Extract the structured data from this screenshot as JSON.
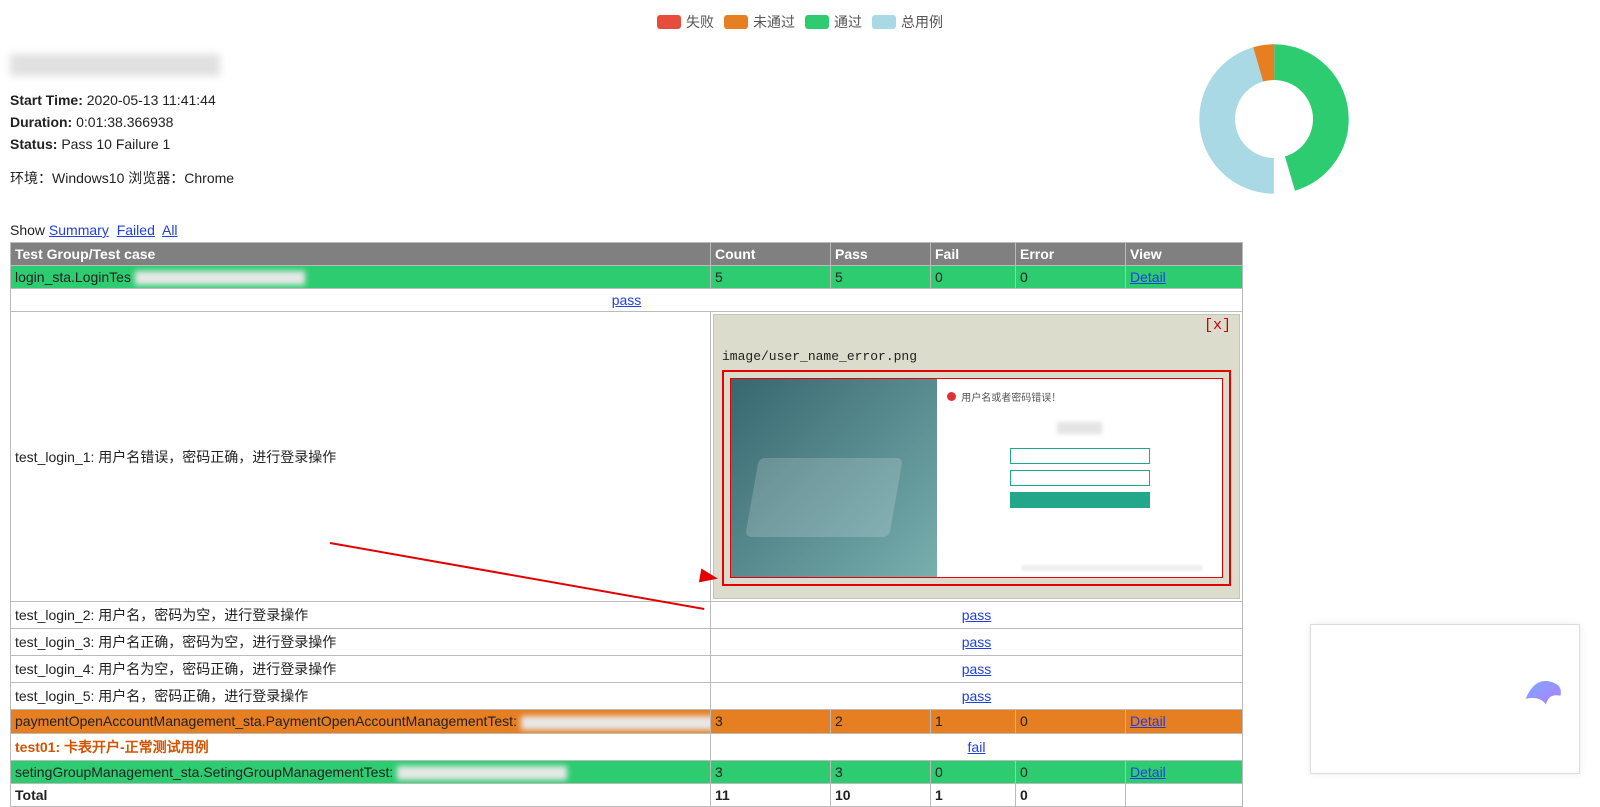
{
  "legend": {
    "fail": {
      "label": "失败",
      "color": "#e74c3c"
    },
    "notrun": {
      "label": "未通过",
      "color": "#e67e22"
    },
    "pass": {
      "label": "通过",
      "color": "#2ecc71"
    },
    "total": {
      "label": "总用例",
      "color": "#a9d9e5"
    }
  },
  "meta": {
    "start_label": "Start Time:",
    "start_value": "2020-05-13 11:41:44",
    "duration_label": "Duration:",
    "duration_value": "0:01:38.366938",
    "status_label": "Status:",
    "status_value": "Pass 10 Failure 1",
    "env": "环境：Windows10 浏览器：Chrome"
  },
  "show_line": {
    "prefix": "Show",
    "summary": "Summary",
    "failed": "Failed",
    "all": "All"
  },
  "columns": {
    "c0": "Test Group/Test case",
    "c1": "Count",
    "c2": "Pass",
    "c3": "Fail",
    "c4": "Error",
    "c5": "View"
  },
  "groups": {
    "login": {
      "name": "login_sta.LoginTes",
      "count": "5",
      "pass": "5",
      "fail": "0",
      "error": "0",
      "detail": "Detail"
    },
    "login_t1": {
      "name": "test_login_1: 用户名错误，密码正确，进行登录操作",
      "result": "pass"
    },
    "login_t1_detail": {
      "close": "[x]",
      "image_path": "image/user_name_error.png",
      "error_msg": "用户名或者密码错误！"
    },
    "login_t2": {
      "name": "test_login_2: 用户名，密码为空，进行登录操作",
      "result": "pass"
    },
    "login_t3": {
      "name": "test_login_3: 用户名正确，密码为空，进行登录操作",
      "result": "pass"
    },
    "login_t4": {
      "name": "test_login_4: 用户名为空，密码正确，进行登录操作",
      "result": "pass"
    },
    "login_t5": {
      "name": "test_login_5: 用户名，密码正确，进行登录操作",
      "result": "pass"
    },
    "payment": {
      "name": "paymentOpenAccountManagement_sta.PaymentOpenAccountManagementTest:",
      "count": "3",
      "pass": "2",
      "fail": "1",
      "error": "0",
      "detail": "Detail"
    },
    "payment_t1": {
      "name": "test01: 卡表开户-正常测试用例",
      "result": "fail"
    },
    "seting": {
      "name": "setingGroupManagement_sta.SetingGroupManagementTest:",
      "count": "3",
      "pass": "3",
      "fail": "0",
      "error": "0",
      "detail": "Detail"
    },
    "total": {
      "name": "Total",
      "count": "11",
      "pass": "10",
      "fail": "1",
      "error": "0"
    }
  },
  "chart_data": {
    "type": "pie",
    "title": "",
    "series": [
      {
        "name": "失败",
        "value": 0,
        "color": "#e74c3c"
      },
      {
        "name": "未通过",
        "value": 1,
        "color": "#e67e22"
      },
      {
        "name": "通过",
        "value": 10,
        "color": "#2ecc71"
      },
      {
        "name": "总用例",
        "value": 11,
        "color": "#a9d9e5"
      }
    ],
    "note": "Donut visually shows three slices: small orange (未通过≈1), green (通过≈10) and light-blue (总用例≈11) forming the ring; center is hollow."
  }
}
